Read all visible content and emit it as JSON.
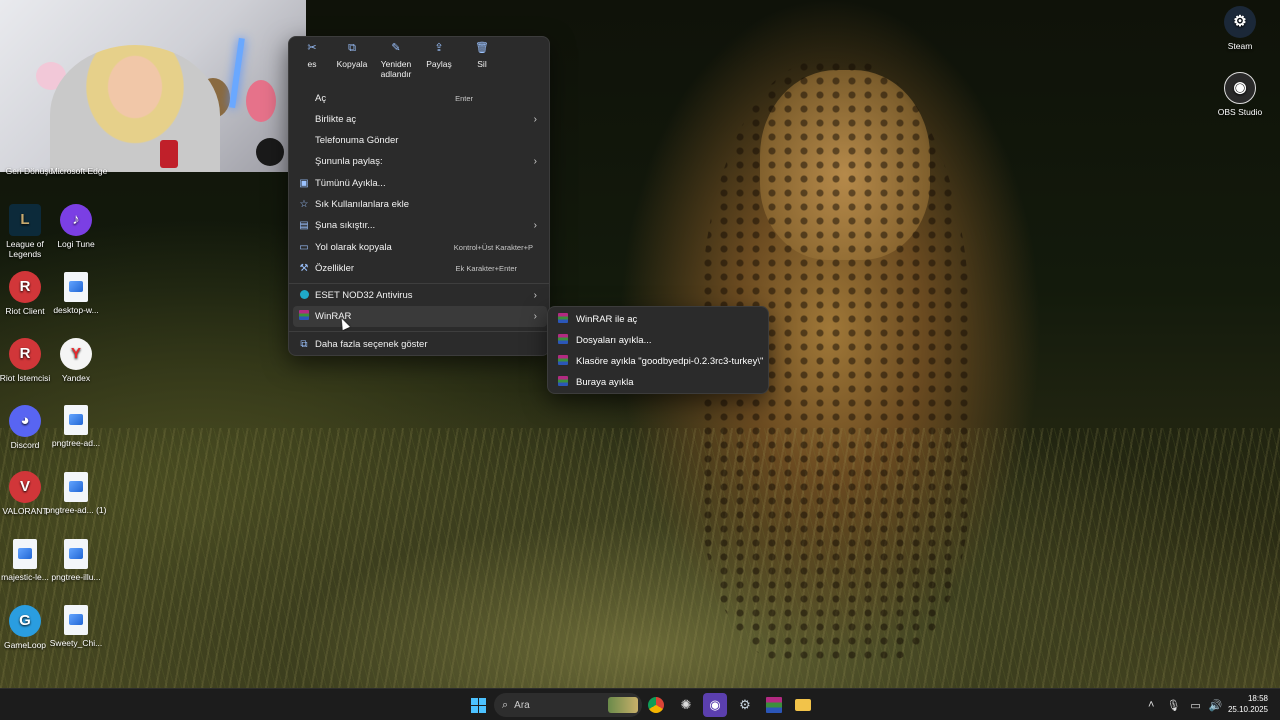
{
  "desktop_left": [
    {
      "label": "Geri Dönüşü...",
      "icon": "recycle-bin-icon"
    },
    {
      "label": "Microsoft Edge",
      "icon": "edge-icon"
    },
    {
      "label": "League of Legends",
      "icon": "league-of-legends-icon"
    },
    {
      "label": "Logi Tune",
      "icon": "logi-tune-icon"
    },
    {
      "label": "Riot Client",
      "icon": "riot-client-icon"
    },
    {
      "label": "desktop-w...",
      "icon": "image-file-icon"
    },
    {
      "label": "Riot İstemcisi",
      "icon": "riot-client-icon"
    },
    {
      "label": "Yandex",
      "icon": "yandex-icon"
    },
    {
      "label": "Discord",
      "icon": "discord-icon"
    },
    {
      "label": "pngtree-ad...",
      "icon": "image-file-icon"
    },
    {
      "label": "VALORANT",
      "icon": "valorant-icon"
    },
    {
      "label": "pngtree-ad... (1)",
      "icon": "image-file-icon"
    },
    {
      "label": "majestic-le...",
      "icon": "image-file-icon"
    },
    {
      "label": "pngtree-illu...",
      "icon": "image-file-icon"
    },
    {
      "label": "GameLoop",
      "icon": "gameloop-icon"
    },
    {
      "label": "Sweety_Chi...",
      "icon": "image-file-icon"
    }
  ],
  "desktop_right": [
    {
      "label": "Steam",
      "icon": "steam-icon"
    },
    {
      "label": "OBS Studio",
      "icon": "obs-icon"
    }
  ],
  "context_menu": {
    "toolbar": [
      {
        "label": "es",
        "icon": "cut-icon"
      },
      {
        "label": "Kopyala",
        "icon": "copy-icon"
      },
      {
        "label": "Yeniden adlandır",
        "icon": "rename-icon"
      },
      {
        "label": "Paylaş",
        "icon": "share-icon"
      },
      {
        "label": "Sil",
        "icon": "delete-icon"
      }
    ],
    "items": [
      {
        "label": "Aç",
        "shortcut": "Enter"
      },
      {
        "label": "Birlikte aç",
        "submenu": true
      },
      {
        "label": "Telefonuma Gönder"
      },
      {
        "label": "Şununla paylaş:",
        "submenu": true
      },
      {
        "label": "Tümünü Ayıkla...",
        "icon": "extract-icon"
      },
      {
        "label": "Sık Kullanılanlara ekle",
        "icon": "star-icon"
      },
      {
        "label": "Şuna sıkıştır...",
        "icon": "compress-icon",
        "submenu": true
      },
      {
        "label": "Yol olarak kopyala",
        "icon": "copy-path-icon",
        "shortcut": "Kontrol+Üst Karakter+P"
      },
      {
        "label": "Özellikler",
        "icon": "wrench-icon",
        "shortcut": "Ek Karakter+Enter"
      },
      {
        "label": "ESET NOD32 Antivirus",
        "icon": "eset-icon",
        "submenu": true
      },
      {
        "label": "WinRAR",
        "icon": "winrar-icon",
        "submenu": true
      },
      {
        "label": "Daha fazla seçenek göster",
        "icon": "more-options-icon"
      }
    ]
  },
  "winrar_submenu": [
    {
      "label": "WinRAR ile aç"
    },
    {
      "label": "Dosyaları ayıkla..."
    },
    {
      "label": "Klasöre ayıkla \"goodbyedpi-0.2.3rc3-turkey\\\""
    },
    {
      "label": "Buraya ayıkla"
    }
  ],
  "taskbar": {
    "search_placeholder": "Ara",
    "time": "18:58",
    "date": "25.10.2025"
  }
}
